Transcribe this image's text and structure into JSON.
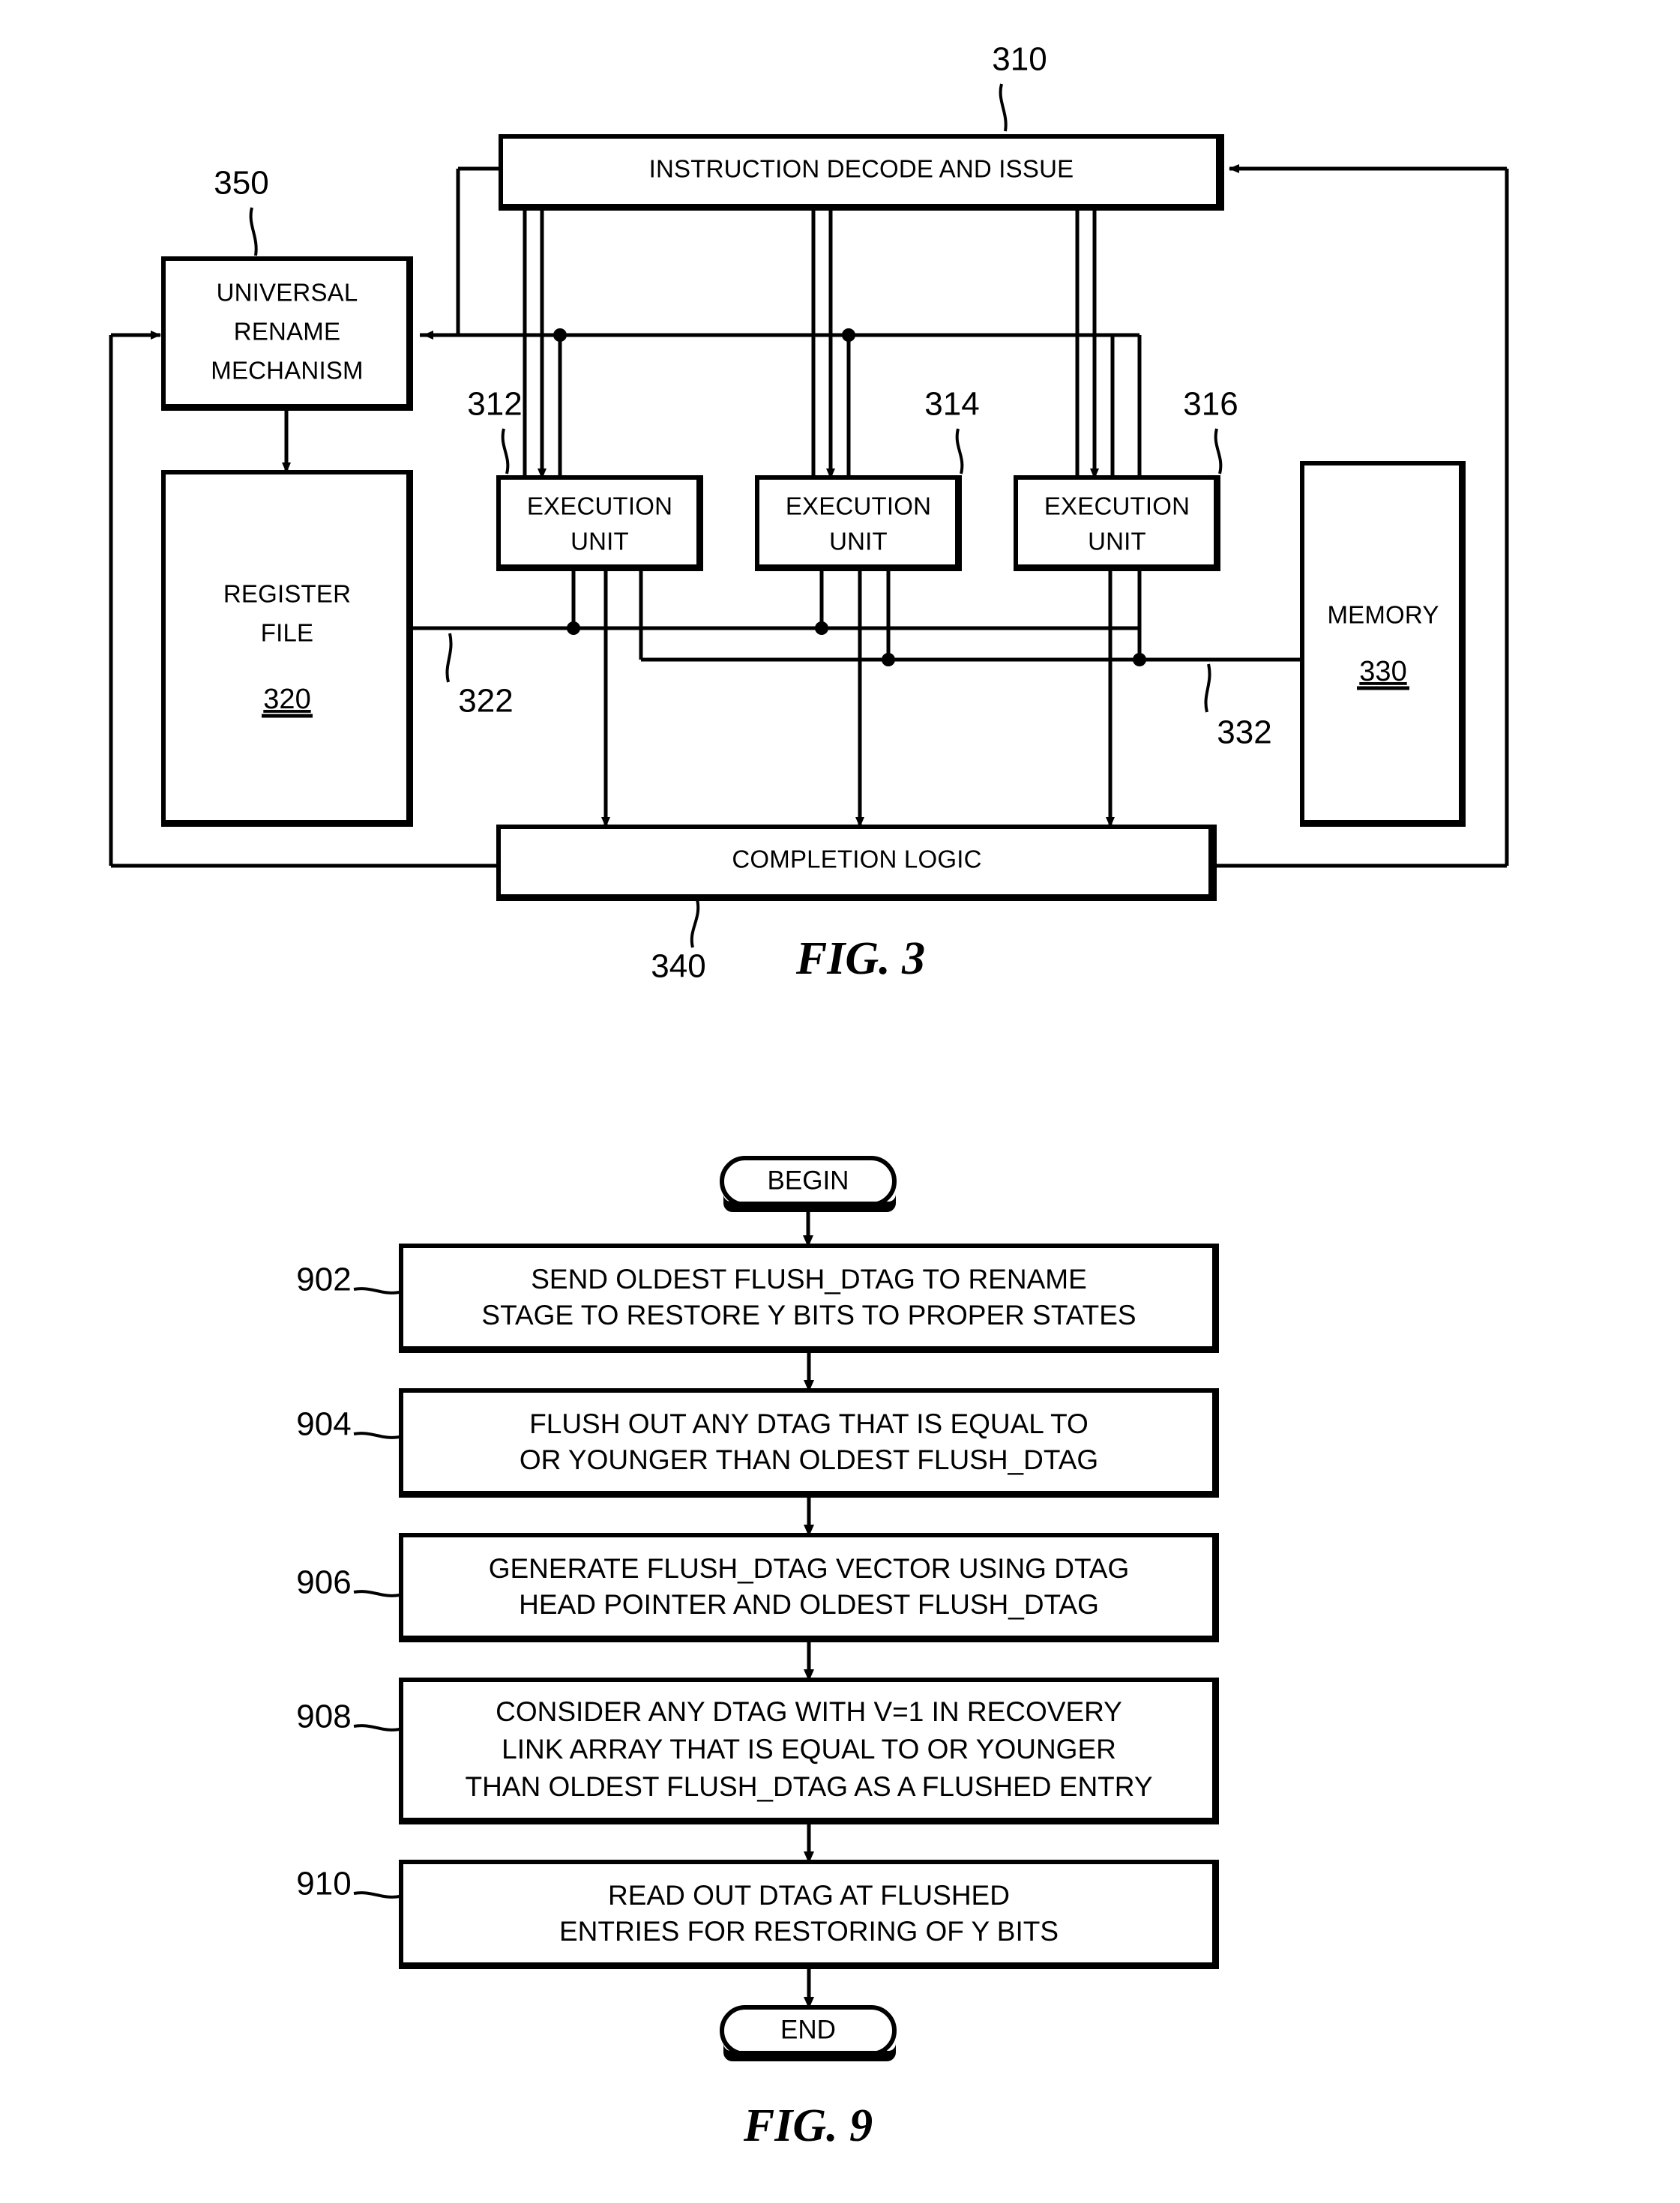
{
  "figure3": {
    "caption": "FIG. 3",
    "blocks": {
      "decode": {
        "label": "INSTRUCTION DECODE AND ISSUE",
        "ref": "310"
      },
      "rename": {
        "line1": "UNIVERSAL",
        "line2": "RENAME",
        "line3": "MECHANISM",
        "ref": "350"
      },
      "register_file": {
        "line1": "REGISTER",
        "line2": "FILE",
        "ref_inline": "320"
      },
      "eu1": {
        "line1": "EXECUTION",
        "line2": "UNIT",
        "ref": "312"
      },
      "eu2": {
        "line1": "EXECUTION",
        "line2": "UNIT",
        "ref": "314"
      },
      "eu3": {
        "line1": "EXECUTION",
        "line2": "UNIT",
        "ref": "316"
      },
      "memory": {
        "label": "MEMORY",
        "ref_inline": "330"
      },
      "completion": {
        "label": "COMPLETION LOGIC",
        "ref": "340"
      }
    },
    "bus_refs": {
      "register_bus": "322",
      "memory_bus": "332"
    }
  },
  "figure9": {
    "caption": "FIG. 9",
    "begin": "BEGIN",
    "end": "END",
    "steps": [
      {
        "ref": "902",
        "lines": [
          "SEND OLDEST FLUSH_DTAG TO RENAME",
          "STAGE TO RESTORE Y BITS TO PROPER STATES"
        ]
      },
      {
        "ref": "904",
        "lines": [
          "FLUSH OUT ANY DTAG THAT IS EQUAL TO",
          "OR YOUNGER THAN OLDEST FLUSH_DTAG"
        ]
      },
      {
        "ref": "906",
        "lines": [
          "GENERATE FLUSH_DTAG VECTOR USING DTAG",
          "HEAD POINTER AND OLDEST FLUSH_DTAG"
        ]
      },
      {
        "ref": "908",
        "lines": [
          "CONSIDER ANY DTAG WITH V=1 IN RECOVERY",
          "LINK ARRAY THAT IS EQUAL TO OR YOUNGER",
          "THAN OLDEST FLUSH_DTAG AS A FLUSHED ENTRY"
        ]
      },
      {
        "ref": "910",
        "lines": [
          "READ OUT DTAG AT FLUSHED",
          "ENTRIES FOR RESTORING OF Y BITS"
        ]
      }
    ]
  },
  "colors": {
    "ink": "#000000",
    "paper": "#ffffff"
  }
}
